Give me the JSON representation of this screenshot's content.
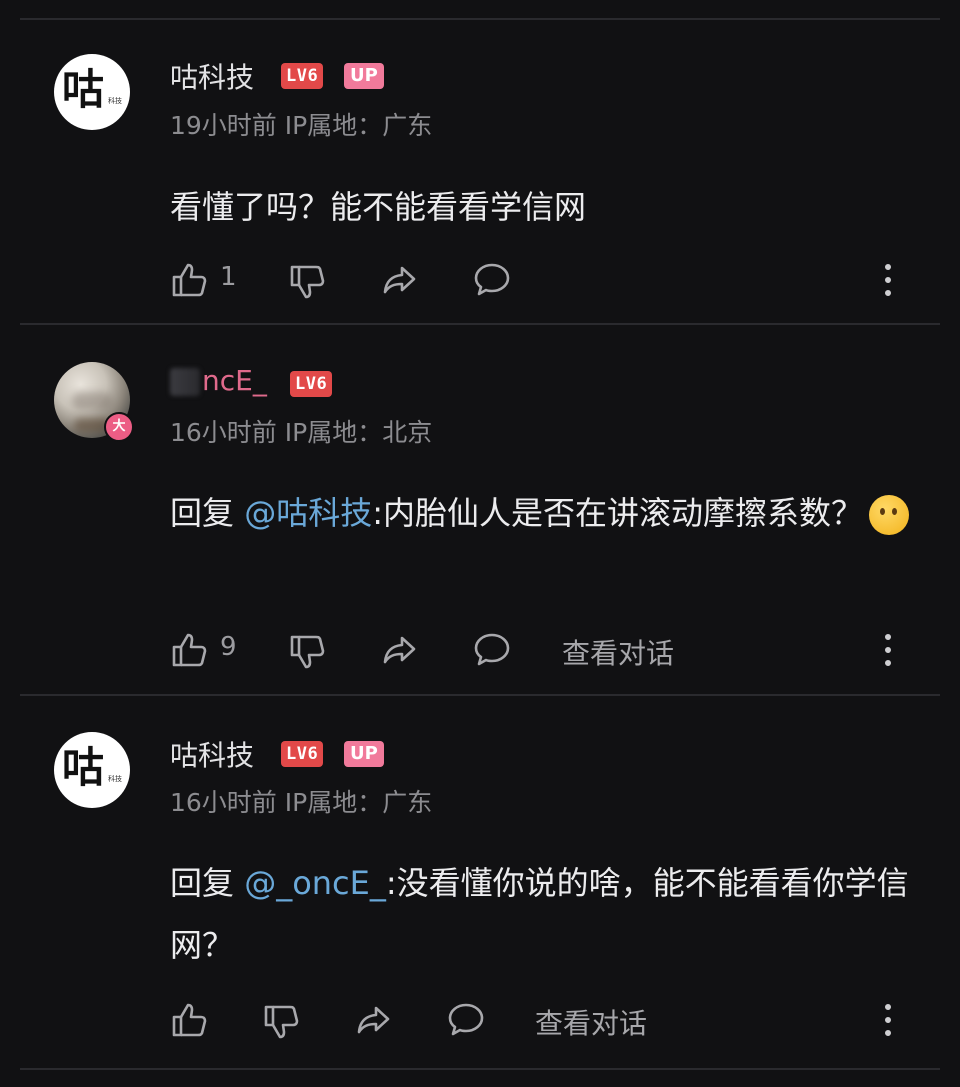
{
  "comments": [
    {
      "avatar_text": "咕",
      "avatar_small": "科技",
      "username": "咕科技",
      "level": "LV6",
      "up_badge": "UP",
      "meta": "19小时前 IP属地：广东",
      "text": "看懂了吗？能不能看看学信网",
      "likes": "1",
      "view_convo": ""
    },
    {
      "username_visible": "ncE_",
      "level": "LV6",
      "vip_badge": "大",
      "meta": "16小时前 IP属地：北京",
      "reply_prefix": "回复 ",
      "mention": "@咕科技",
      "text": ":内胎仙人是否在讲滚动摩擦系数？",
      "likes": "9",
      "view_convo": "查看对话"
    },
    {
      "avatar_text": "咕",
      "avatar_small": "科技",
      "username": "咕科技",
      "level": "LV6",
      "up_badge": "UP",
      "meta": "16小时前 IP属地：广东",
      "reply_prefix": "回复 ",
      "mention": "@_oncE_",
      "text": ":没看懂你说的啥，能不能看看你学信网？",
      "likes": "",
      "view_convo": "查看对话"
    }
  ],
  "icons": {
    "like": "thumbs-up-icon",
    "dislike": "thumbs-down-icon",
    "share": "share-icon",
    "reply": "comment-icon",
    "more": "more-vertical-icon"
  },
  "colors": {
    "background": "#111113",
    "level_badge": "#e24949",
    "up_badge": "#f17a9b",
    "mention": "#6aa8d8"
  }
}
